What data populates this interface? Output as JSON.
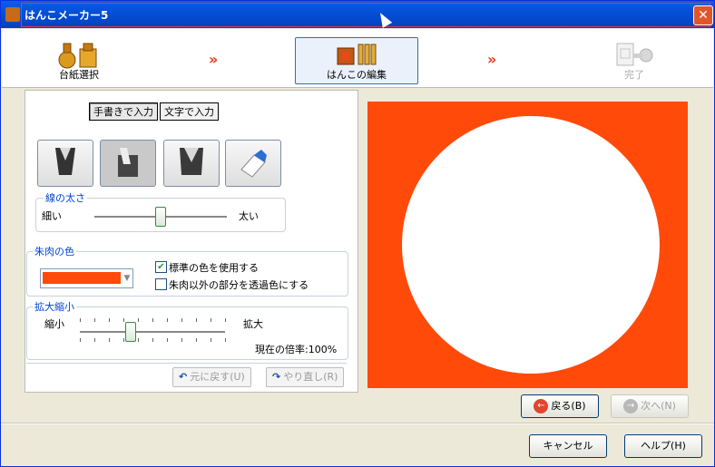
{
  "window": {
    "title": "はんこメーカー5",
    "close_label": "✕"
  },
  "wizard": {
    "steps": [
      {
        "label": "台紙選択",
        "state": "done"
      },
      {
        "label": "はんこの編集",
        "state": "current"
      },
      {
        "label": "完了",
        "state": "pending"
      }
    ],
    "arrow": "»"
  },
  "input_modes": {
    "handwritten": "手書きで入力",
    "text": "文字で入力",
    "active": "handwritten"
  },
  "tools": [
    "brush-icon",
    "marker-icon",
    "pen-icon",
    "eraser-icon"
  ],
  "line_width": {
    "title": "線の太さ",
    "min_label": "細い",
    "max_label": "太い",
    "value": 0.5
  },
  "ink_color": {
    "title": "朱肉の色",
    "color": "#ff4a0a",
    "use_standard_label": "標準の色を使用する",
    "use_standard_checked": true,
    "transparent_label": "朱肉以外の部分を透過色にする",
    "transparent_checked": false
  },
  "zoom": {
    "title": "拡大縮小",
    "min_label": "縮小",
    "max_label": "拡大",
    "current_text": "現在の倍率:100%",
    "value": 0.35
  },
  "history": {
    "undo_label": "元に戻す(U)",
    "redo_label": "やり直し(R)"
  },
  "preview": {
    "background": "#ff4a0a",
    "fill": "#ffffff"
  },
  "nav": {
    "back_label": "戻る(B)",
    "next_label": "次へ(N)",
    "cancel_label": "キャンセル",
    "help_label": "ヘルプ(H)"
  }
}
